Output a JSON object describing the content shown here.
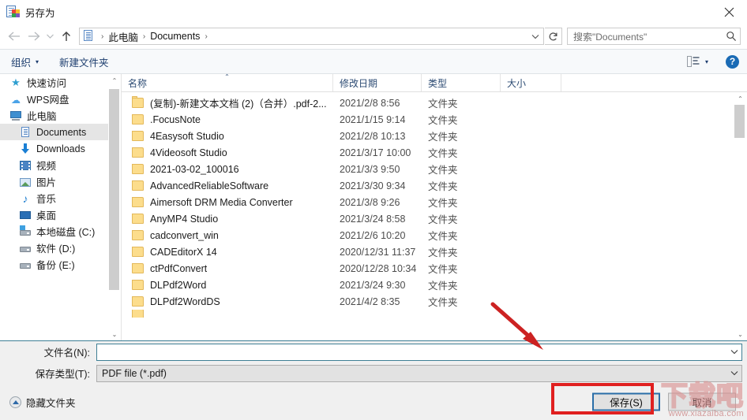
{
  "window": {
    "title": "另存为",
    "app_icon": "save-as-icon",
    "close_label": "✕"
  },
  "nav": {
    "back": "←",
    "forward": "→",
    "recent": "⌄",
    "up": "↑",
    "breadcrumb": {
      "root_icon": "documents-icon",
      "separator": "›",
      "items": [
        "此电脑",
        "Documents"
      ]
    },
    "dropdown_caret": "⌄",
    "refresh": "↻",
    "search_placeholder": "搜索\"Documents\"",
    "search_icon": "search-icon"
  },
  "toolbar": {
    "organize_label": "组织",
    "organize_caret": "▾",
    "new_folder_label": "新建文件夹",
    "view_icon": "list-view-icon",
    "view_caret": "▾",
    "help_label": "?"
  },
  "sidebar": {
    "items": [
      {
        "label": "快速访问",
        "icon": "star-icon",
        "indent": false,
        "selected": false
      },
      {
        "label": "WPS网盘",
        "icon": "cloud-icon",
        "indent": false,
        "selected": false
      },
      {
        "label": "此电脑",
        "icon": "computer-icon",
        "indent": false,
        "selected": false
      },
      {
        "label": "Documents",
        "icon": "documents-icon",
        "indent": true,
        "selected": true
      },
      {
        "label": "Downloads",
        "icon": "downloads-icon",
        "indent": true,
        "selected": false
      },
      {
        "label": "视频",
        "icon": "videos-icon",
        "indent": true,
        "selected": false
      },
      {
        "label": "图片",
        "icon": "pictures-icon",
        "indent": true,
        "selected": false
      },
      {
        "label": "音乐",
        "icon": "music-icon",
        "indent": true,
        "selected": false
      },
      {
        "label": "桌面",
        "icon": "desktop-icon",
        "indent": true,
        "selected": false
      },
      {
        "label": "本地磁盘 (C:)",
        "icon": "system-disk-icon",
        "indent": true,
        "selected": false
      },
      {
        "label": "软件 (D:)",
        "icon": "disk-icon",
        "indent": true,
        "selected": false
      },
      {
        "label": "备份 (E:)",
        "icon": "disk-icon",
        "indent": true,
        "selected": false
      }
    ],
    "scroll_up": "⌃",
    "scroll_down": "⌄"
  },
  "file_list": {
    "columns": [
      {
        "label": "名称",
        "sorted": true,
        "sort_mark": "⌃"
      },
      {
        "label": "修改日期",
        "sorted": false,
        "sort_mark": ""
      },
      {
        "label": "类型",
        "sorted": false,
        "sort_mark": ""
      },
      {
        "label": "大小",
        "sorted": false,
        "sort_mark": ""
      }
    ],
    "rows": [
      {
        "name": "(复制)-新建文本文档 (2)（合并）.pdf-2...",
        "date": "2021/2/8 8:56",
        "type": "文件夹",
        "size": ""
      },
      {
        "name": ".FocusNote",
        "date": "2021/1/15 9:14",
        "type": "文件夹",
        "size": ""
      },
      {
        "name": "4Easysoft Studio",
        "date": "2021/2/8 10:13",
        "type": "文件夹",
        "size": ""
      },
      {
        "name": "4Videosoft Studio",
        "date": "2021/3/17 10:00",
        "type": "文件夹",
        "size": ""
      },
      {
        "name": "2021-03-02_100016",
        "date": "2021/3/3 9:50",
        "type": "文件夹",
        "size": ""
      },
      {
        "name": "AdvancedReliableSoftware",
        "date": "2021/3/30 9:34",
        "type": "文件夹",
        "size": ""
      },
      {
        "name": "Aimersoft DRM Media Converter",
        "date": "2021/3/8 9:26",
        "type": "文件夹",
        "size": ""
      },
      {
        "name": "AnyMP4 Studio",
        "date": "2021/3/24 8:58",
        "type": "文件夹",
        "size": ""
      },
      {
        "name": "cadconvert_win",
        "date": "2021/2/6 10:20",
        "type": "文件夹",
        "size": ""
      },
      {
        "name": "CADEditorX 14",
        "date": "2020/12/31 11:37",
        "type": "文件夹",
        "size": ""
      },
      {
        "name": "ctPdfConvert",
        "date": "2020/12/28 10:34",
        "type": "文件夹",
        "size": ""
      },
      {
        "name": "DLPdf2Word",
        "date": "2021/3/24 9:30",
        "type": "文件夹",
        "size": ""
      },
      {
        "name": "DLPdf2WordDS",
        "date": "2021/4/2 8:35",
        "type": "文件夹",
        "size": ""
      }
    ],
    "scroll_up": "⌃",
    "scroll_down": "⌄"
  },
  "footer": {
    "filename_label": "文件名(N):",
    "filename_value": "",
    "filetype_label": "保存类型(T):",
    "filetype_value": "PDF file (*.pdf)",
    "dropdown_caret": "⌄",
    "hide_folders_label": "隐藏文件夹",
    "save_button": "保存(S)",
    "cancel_button": "取消"
  },
  "annotations": {
    "highlight_color": "#e02020",
    "arrow_color": "#cc2222",
    "arrow_target": "filename-input"
  },
  "watermark": {
    "text": "下载吧",
    "url": "www.xiazaiba.com"
  }
}
